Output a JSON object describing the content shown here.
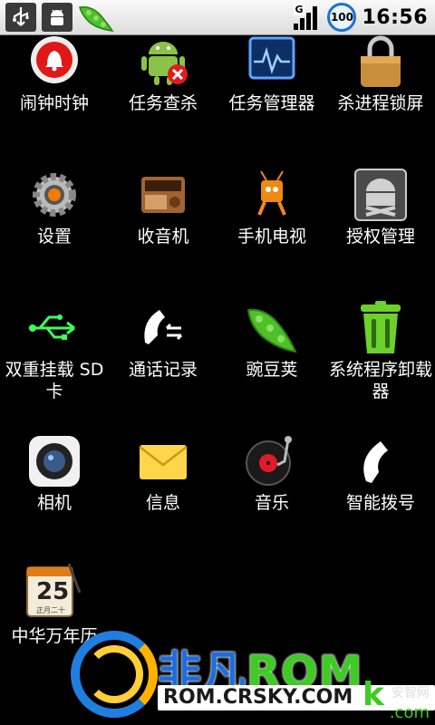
{
  "status_bar": {
    "icons": [
      "usb-icon",
      "android-debug-icon",
      "peapod-icon"
    ],
    "signal_label": "G",
    "battery": "100",
    "time": "16:56"
  },
  "apps": [
    {
      "label": "闹钟时钟",
      "icon": "alarm-clock-icon"
    },
    {
      "label": "任务查杀",
      "icon": "task-killer-icon"
    },
    {
      "label": "任务管理器",
      "icon": "task-manager-icon"
    },
    {
      "label": "杀进程锁屏",
      "icon": "padlock-icon"
    },
    {
      "label": "设置",
      "icon": "settings-gear-icon"
    },
    {
      "label": "收音机",
      "icon": "radio-icon"
    },
    {
      "label": "手机电视",
      "icon": "mobile-tv-icon"
    },
    {
      "label": "授权管理",
      "icon": "superuser-icon"
    },
    {
      "label": "双重挂载 SD卡",
      "icon": "usb-mount-icon"
    },
    {
      "label": "通话记录",
      "icon": "call-log-icon"
    },
    {
      "label": "豌豆荚",
      "icon": "wandoujia-icon"
    },
    {
      "label": "系统程序卸载器",
      "icon": "uninstaller-trash-icon"
    },
    {
      "label": "相机",
      "icon": "camera-icon"
    },
    {
      "label": "信息",
      "icon": "messages-envelope-icon"
    },
    {
      "label": "音乐",
      "icon": "music-record-icon"
    },
    {
      "label": "智能拨号",
      "icon": "phone-handset-icon"
    },
    {
      "label": "中华万年历",
      "icon": "calendar-icon",
      "icon_text": "25",
      "icon_subtext": "正月二十"
    }
  ],
  "watermark": {
    "title_a": "非凡",
    "title_b": "ROM",
    "subtitle": "ROM.CRSKY.COM",
    "k": "k",
    "site": "安智网",
    "com": ".com"
  }
}
